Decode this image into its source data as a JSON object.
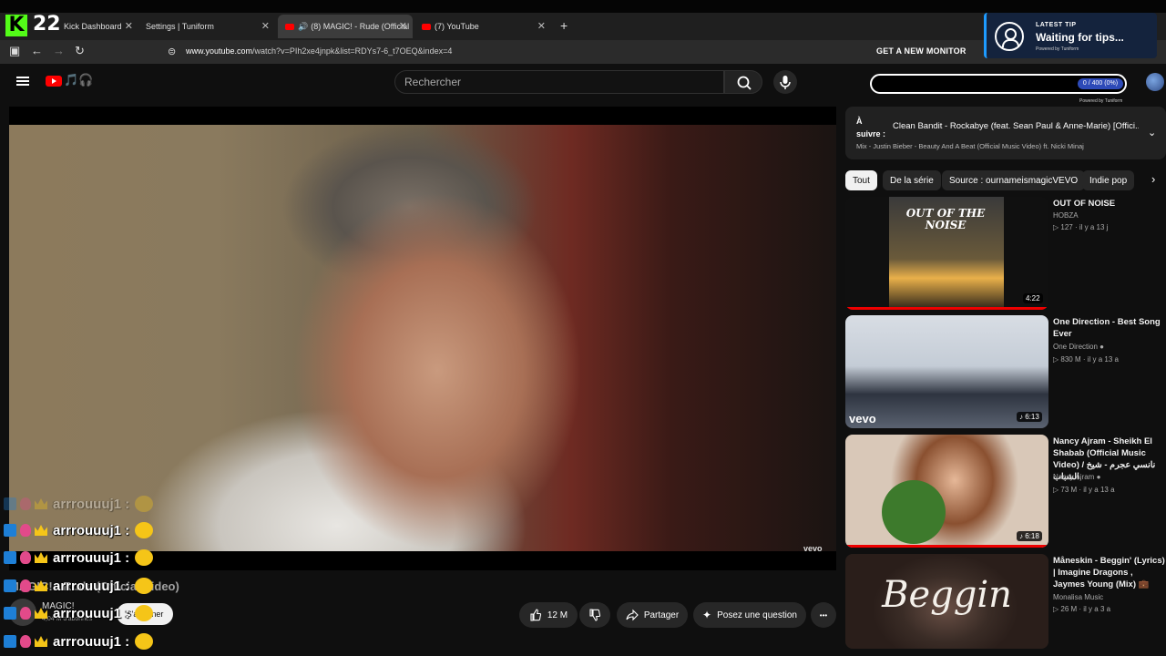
{
  "browser": {
    "kick_count": "22",
    "tabs": [
      {
        "label": "Kick Dashboard"
      },
      {
        "label": "Settings | Tuniform"
      },
      {
        "label": "(8) MAGIC! - Rude (Official"
      },
      {
        "label": "(7) YouTube"
      }
    ],
    "new_tab": "+",
    "url_host": "www.youtube.com",
    "url_path": "/watch?v=PIh2xe4jnpk&list=RDYs7-6_t7OEQ&index=4",
    "promo": "GET A NEW MONITOR"
  },
  "tip_widget": {
    "title": "LATEST TIP",
    "text": "Waiting for tips...",
    "powered": "Powered by Tuniform",
    "goal_label": "0 / 400 (0%)",
    "goal_fraction": 0,
    "goal_powered": "Powered by Tuniform"
  },
  "youtube": {
    "search_placeholder": "Rechercher",
    "logo_doodle": "🎵🎧"
  },
  "video": {
    "watermark": "vevo",
    "actions": {
      "likes": "12 M",
      "share": "Partager",
      "ask": "Posez une question",
      "more": "•••"
    },
    "channel_fragment": "MAGIC!",
    "subs_fragment": "4,04 M d'abonnés",
    "subscribe_fragment": "S'abonner",
    "title_fragment": "MAGIC! - Rude (Official Video)"
  },
  "chat": {
    "lines": [
      {
        "name": "arrrouuuj1 :"
      },
      {
        "name": "arrrouuuj1 :"
      },
      {
        "name": "arrrouuuj1 :"
      },
      {
        "name": "arrrouuuj1 :"
      },
      {
        "name": "arrrouuuj1 :"
      },
      {
        "name": "arrrouuuj1 :"
      }
    ]
  },
  "up_next": {
    "label": "À suivre :",
    "title": "Clean Bandit - Rockabye (feat. Sean Paul & Anne-Marie) [Offici...",
    "mix": "Mix - Justin Bieber - Beauty And A Beat (Official Music Video) ft. Nicki Minaj"
  },
  "chips": [
    "Tout",
    "De la série",
    "Source : ournameismagicVEVO",
    "Indie pop"
  ],
  "recommendations": [
    {
      "title": "OUT OF NOISE",
      "channel": "HOBZA",
      "meta": "▷ 127 · il y a 13 j",
      "duration": "4:22",
      "thumb_text": "OUT OF THE NOISE"
    },
    {
      "title": "One Direction - Best Song Ever",
      "channel": "One Direction",
      "meta": "▷ 830 M · il y a 13 a",
      "duration": "6:13",
      "thumb_text": "vevo"
    },
    {
      "title": "Nancy Ajram - Sheikh El Shabab (Official Music Video) / نانسي عجرم - شيخ الشباب",
      "channel": "Nancy Ajram",
      "meta": "▷ 73 M · il y a 13 a",
      "duration": "6:18",
      "thumb_text": ""
    },
    {
      "title": "Måneskin - Beggin' (Lyrics) | Imagine Dragons , Jaymes Young (Mix) 💼",
      "channel": "Monalisa Music",
      "meta": "▷ 26 M · il y a 3 a",
      "duration": "",
      "thumb_text": "Beggin"
    }
  ]
}
